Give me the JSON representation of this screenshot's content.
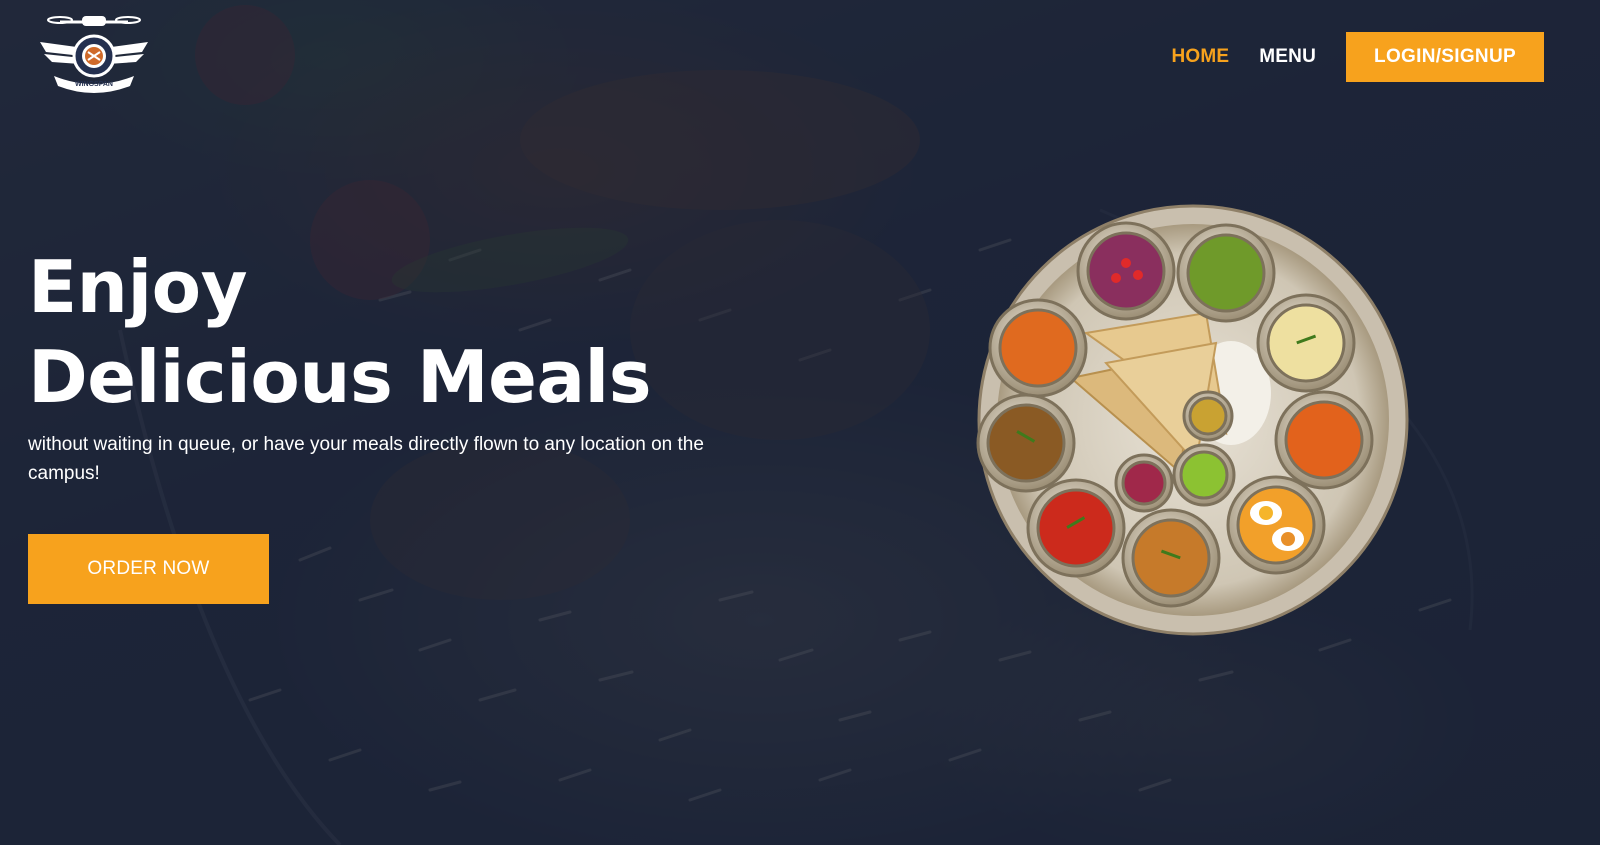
{
  "brand": {
    "logo_text": "WINGSPAN"
  },
  "nav": {
    "items": [
      {
        "label": "HOME",
        "active": true
      },
      {
        "label": "MENU",
        "active": false
      }
    ],
    "login_label": "LOGIN/SIGNUP"
  },
  "hero": {
    "headline_line1": "Enjoy",
    "headline_line2": "Delicious Meals",
    "subtext": "without waiting in queue, or have your meals directly flown to any location on the campus!",
    "cta_label": "ORDER NOW"
  },
  "colors": {
    "accent": "#f7a21d",
    "overlay": "#182034",
    "text": "#ffffff"
  },
  "icons": {
    "logo": "drone-emblem-icon",
    "hero_image": "thali-plate-image"
  }
}
